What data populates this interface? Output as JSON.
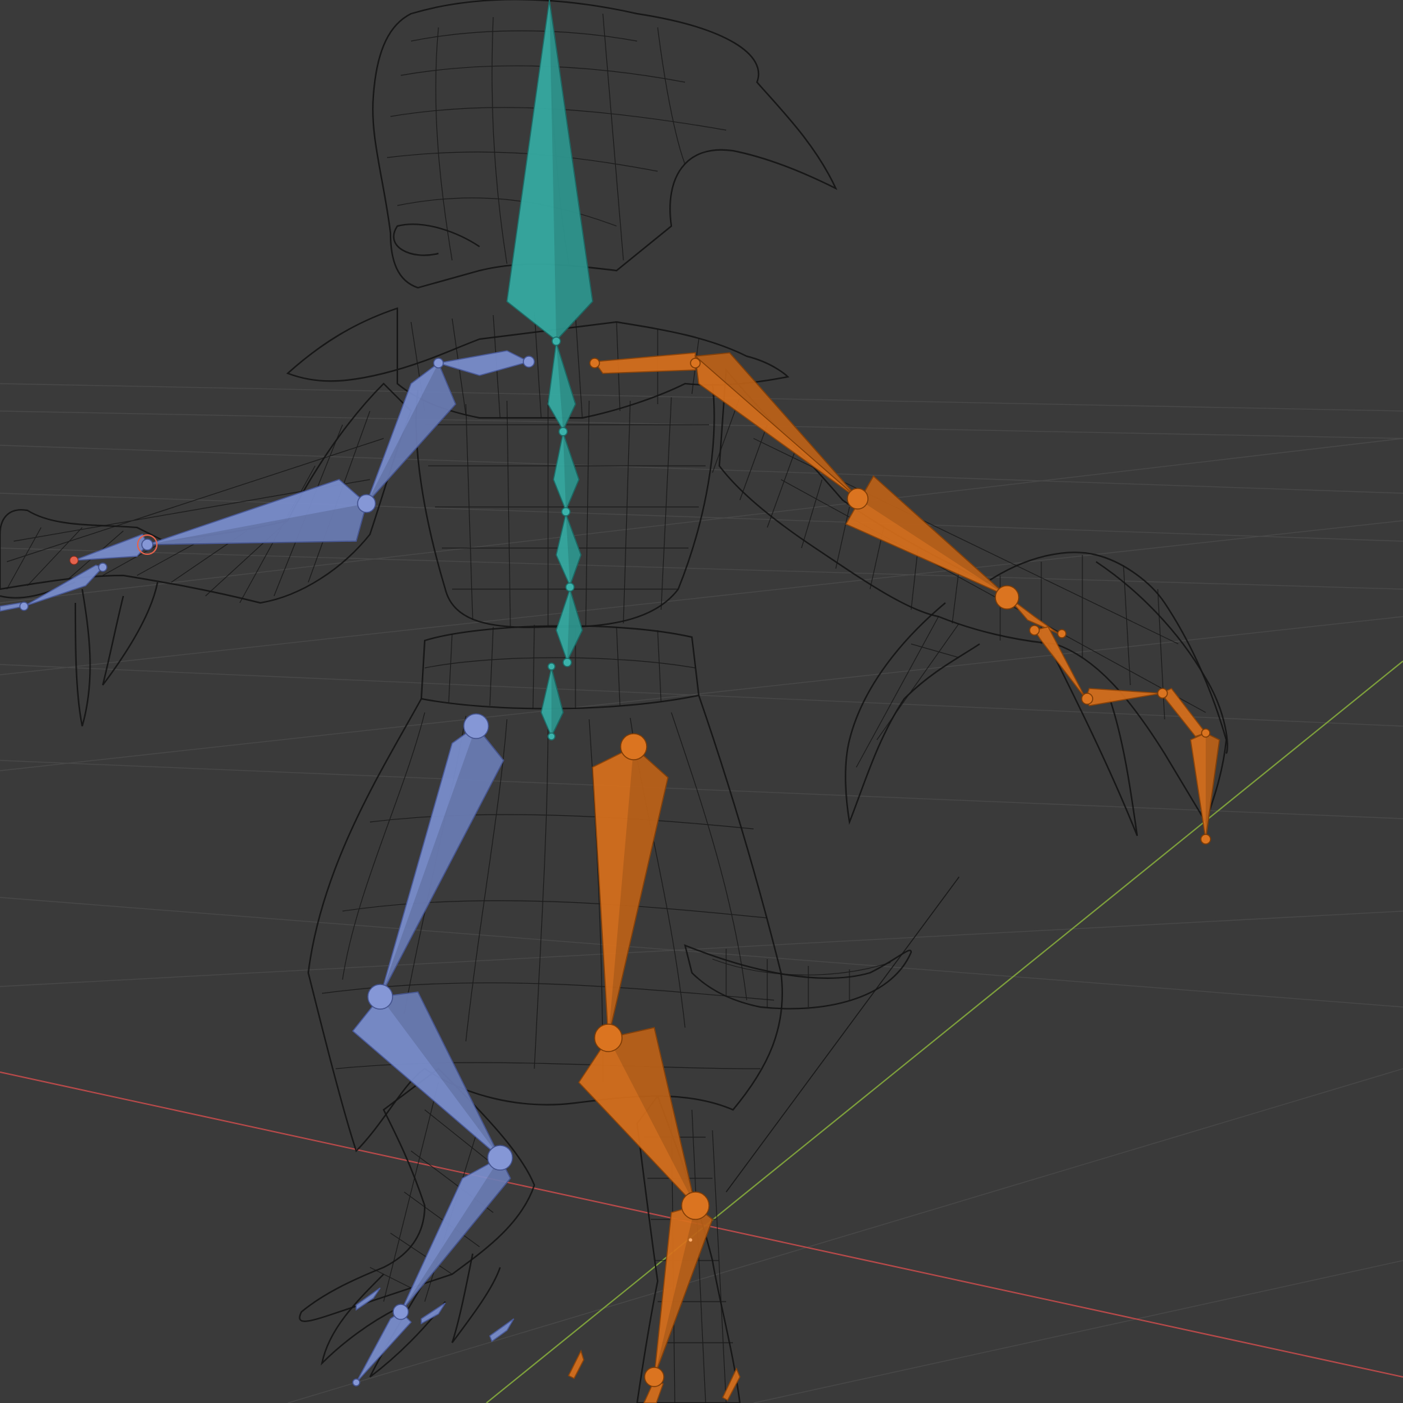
{
  "viewport": {
    "background": "#3a3a3a",
    "colors": {
      "grid": "#484848",
      "x_axis": "#b84a4a",
      "y_axis": "#7ea03c",
      "wireframe": "#141414",
      "bone_left": "#7b8fcf",
      "bone_right": "#d8701c",
      "bone_spine": "#35aaa2",
      "bone_selected_outline": "#e5634d"
    },
    "icons": {
      "armature": "armature-icon",
      "mesh": "wireframe-mesh-icon"
    }
  }
}
